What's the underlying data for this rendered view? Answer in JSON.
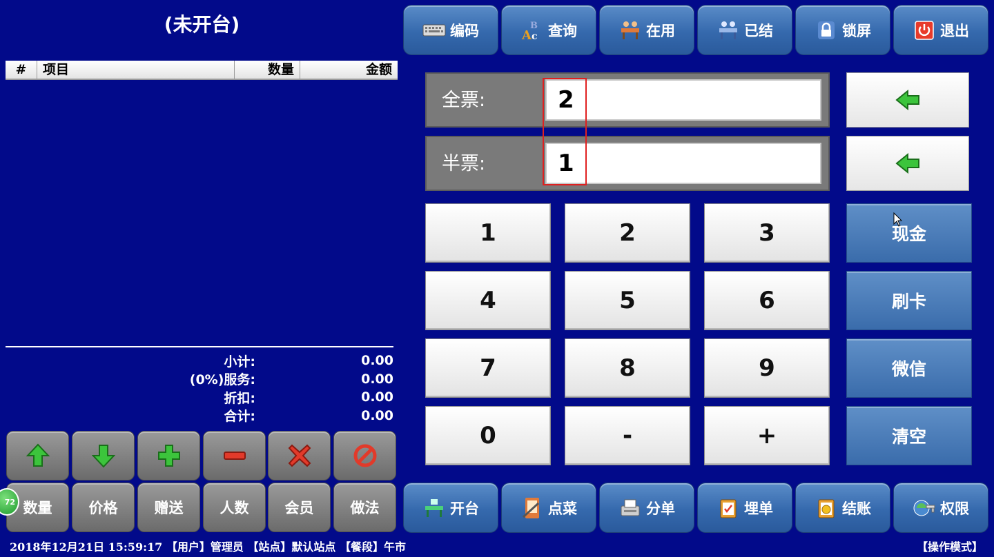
{
  "title": "(未开台)",
  "order_table": {
    "columns": [
      "#",
      "项目",
      "数量",
      "金额"
    ],
    "rows": []
  },
  "totals": [
    {
      "label": "小计:",
      "value": "0.00"
    },
    {
      "label": "(0%)服务:",
      "value": "0.00"
    },
    {
      "label": "折扣:",
      "value": "0.00"
    },
    {
      "label": "合计:",
      "value": "0.00"
    }
  ],
  "edit_buttons": [
    "up-arrow-icon",
    "down-arrow-icon",
    "plus-icon",
    "minus-icon",
    "delete-x-icon",
    "cancel-icon"
  ],
  "func_buttons": [
    "数量",
    "价格",
    "赠送",
    "人数",
    "会员",
    "做法"
  ],
  "badge": "72",
  "top_toolbar": [
    {
      "label": "编码",
      "icon": "keyboard-icon"
    },
    {
      "label": "查询",
      "icon": "abc-search-icon"
    },
    {
      "label": "在用",
      "icon": "occupied-table-icon"
    },
    {
      "label": "已结",
      "icon": "settled-table-icon"
    },
    {
      "label": "锁屏",
      "icon": "lock-icon"
    },
    {
      "label": "退出",
      "icon": "power-icon"
    }
  ],
  "tickets": {
    "full_label": "全票:",
    "full_value": "2",
    "half_label": "半票:",
    "half_value": "1"
  },
  "keypad": [
    "1",
    "2",
    "3",
    "4",
    "5",
    "6",
    "7",
    "8",
    "9",
    "0",
    "-",
    "+"
  ],
  "payment": [
    "现金",
    "刷卡",
    "微信",
    "清空"
  ],
  "bottom_toolbar": [
    {
      "label": "开台",
      "icon": "open-table-icon"
    },
    {
      "label": "点菜",
      "icon": "order-dish-icon"
    },
    {
      "label": "分单",
      "icon": "split-bill-icon"
    },
    {
      "label": "埋单",
      "icon": "bill-icon"
    },
    {
      "label": "结账",
      "icon": "checkout-icon"
    },
    {
      "label": "权限",
      "icon": "permission-icon"
    }
  ],
  "status_bar": {
    "text": "2018年12月21日 15:59:17 【用户】管理员 【站点】默认站点 【餐段】午市",
    "mode": "【操作模式】"
  },
  "colors": {
    "background": "#020a8a",
    "accent_blue": "#3569ad",
    "green_icon": "#2fb52f",
    "red_icon": "#e03a2a"
  }
}
